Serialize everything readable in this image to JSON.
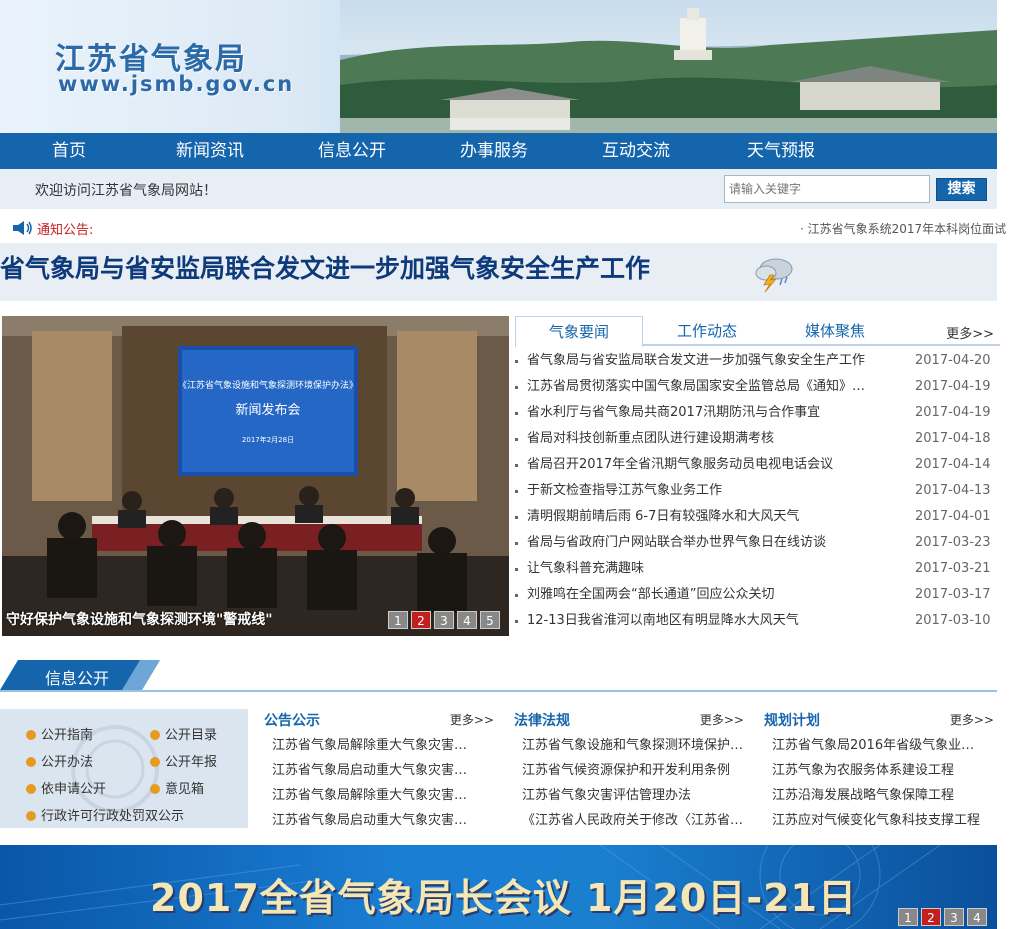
{
  "header": {
    "logo_cn": "江苏省气象局",
    "logo_en": "www.jsmb.gov.cn"
  },
  "nav": [
    {
      "label": "首页"
    },
    {
      "label": "新闻资讯"
    },
    {
      "label": "信息公开"
    },
    {
      "label": "办事服务"
    },
    {
      "label": "互动交流"
    },
    {
      "label": "天气预报"
    }
  ],
  "welcome": {
    "text": "欢迎访问江苏省气象局网站！",
    "search_placeholder": "请输入关键字",
    "search_button": "搜索"
  },
  "notice": {
    "label": "通知公告:",
    "scroll_text": "· 江苏省气象系统2017年本科岗位面试"
  },
  "headline": {
    "text": "省气象局与省安监局联合发文进一步加强气象安全生产工作"
  },
  "slideshow": {
    "screen_title": "《江苏省气象设施和气象探测环境保护办法》",
    "screen_subtitle": "新闻发布会",
    "screen_date": "2017年2月28日",
    "caption": "守好保护气象设施和气象探测环境\"警戒线\"",
    "pages": [
      "1",
      "2",
      "3",
      "4",
      "5"
    ],
    "active_page": "2"
  },
  "news": {
    "tabs": [
      {
        "label": "气象要闻",
        "active": true
      },
      {
        "label": "工作动态",
        "active": false
      },
      {
        "label": "媒体聚焦",
        "active": false
      }
    ],
    "more": "更多>>",
    "items": [
      {
        "title": "省气象局与省安监局联合发文进一步加强气象安全生产工作",
        "date": "2017-04-20"
      },
      {
        "title": "江苏省局贯彻落实中国气象局国家安全监管总局《通知》和…",
        "date": "2017-04-19"
      },
      {
        "title": "省水利厅与省气象局共商2017汛期防汛与合作事宜",
        "date": "2017-04-19"
      },
      {
        "title": "省局对科技创新重点团队进行建设期满考核",
        "date": "2017-04-18"
      },
      {
        "title": "省局召开2017年全省汛期气象服务动员电视电话会议",
        "date": "2017-04-14"
      },
      {
        "title": "于新文检查指导江苏气象业务工作",
        "date": "2017-04-13"
      },
      {
        "title": "清明假期前晴后雨 6-7日有较强降水和大风天气",
        "date": "2017-04-01"
      },
      {
        "title": "省局与省政府门户网站联合举办世界气象日在线访谈",
        "date": "2017-03-23"
      },
      {
        "title": "让气象科普充满趣味",
        "date": "2017-03-21"
      },
      {
        "title": "刘雅鸣在全国两会“部长通道”回应公众关切",
        "date": "2017-03-17"
      },
      {
        "title": "12-13日我省淮河以南地区有明显降水大风天气",
        "date": "2017-03-10"
      }
    ]
  },
  "info": {
    "section_title": "信息公开",
    "links": [
      {
        "label": "公开指南"
      },
      {
        "label": "公开目录"
      },
      {
        "label": "公开办法"
      },
      {
        "label": "公开年报"
      },
      {
        "label": "依申请公开"
      },
      {
        "label": "意见箱"
      },
      {
        "label": "行政许可行政处罚双公示"
      }
    ],
    "columns": [
      {
        "title": "公告公示",
        "more": "更多>>",
        "rows": [
          "江苏省气象局解除重大气象灾害…",
          "江苏省气象局启动重大气象灾害…",
          "江苏省气象局解除重大气象灾害…",
          "江苏省气象局启动重大气象灾害…"
        ]
      },
      {
        "title": "法律法规",
        "more": "更多>>",
        "rows": [
          "江苏省气象设施和气象探测环境保护…",
          "江苏省气候资源保护和开发利用条例",
          "江苏省气象灾害评估管理办法",
          "《江苏省人民政府关于修改〈江苏省…"
        ]
      },
      {
        "title": "规划计划",
        "more": "更多>>",
        "rows": [
          "江苏省气象局2016年省级气象业…",
          "江苏气象为农服务体系建设工程",
          "江苏沿海发展战略气象保障工程",
          "江苏应对气候变化气象科技支撑工程"
        ]
      }
    ]
  },
  "bottom_banner": {
    "title": "2017全省气象局长会议  1月20日-21日",
    "pages": [
      "1",
      "2",
      "3",
      "4"
    ],
    "active_page": "2"
  },
  "colors": {
    "brand_blue": "#1565ad",
    "notice_red": "#c81d1d",
    "headline_navy": "#0d3a7a",
    "pager_active": "#c31f1f"
  }
}
